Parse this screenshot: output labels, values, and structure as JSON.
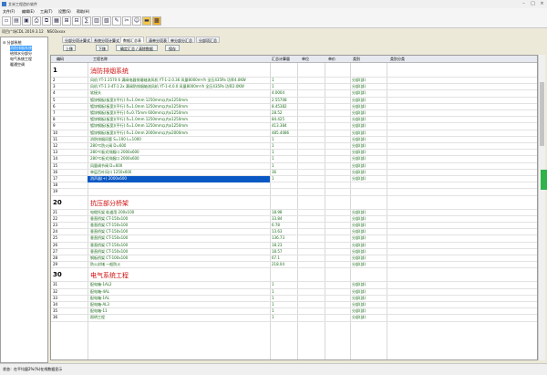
{
  "window": {
    "title": "艾米工程造价软件"
  },
  "menu": [
    "文件(F)",
    "编辑(E)",
    "工具(T)",
    "设置(S)",
    "帮助(H)"
  ],
  "project": {
    "label": "项目广场CDL 2019.3.12",
    "code": "NS03xxxx"
  },
  "tree": {
    "root": "分部系统",
    "items": [
      "消防排烟系统",
      "给排水分部分",
      "电气系统工程",
      "暖通空调"
    ]
  },
  "tabs": [
    "分部分项计算式",
    "系统分项计算式",
    "数据汇总表",
    "清单分项表",
    "单分部分汇总",
    "分部项汇总"
  ],
  "active_tab_index": 2,
  "buttons": {
    "up": "上移",
    "down": "下移",
    "summary": "确定汇总 / 清除数据",
    "save": "保存"
  },
  "columns": [
    "编码",
    "工程名称",
    "汇总计算量",
    "单位",
    "单价",
    "类别",
    "类别分类"
  ],
  "rows": [
    {
      "no": "1",
      "name": "消防排烟系统",
      "kind": "category"
    },
    {
      "no": "2",
      "name": "风机 YT-1 2570 6 满阀电器排烟轴流风机 YT-1-2.0.36 风量8000m³/h 全压435Pa 功率4.0KW",
      "qty": "1",
      "type": "分部(部)"
    },
    {
      "no": "3",
      "name": "风机 YT-1 3·4T-1 2x 满阀防排烟轴流风机 YT-1-4.0.0 风量8000m³/h 全压435Pa 功率2.0KW",
      "qty": "1",
      "type": "分部(部)"
    },
    {
      "no": "4",
      "name": "软接头",
      "qty": "4.0004",
      "type": "分部(部)"
    },
    {
      "no": "5",
      "name": "镀锌钢板(板宽)(平行) δ=1.0mm 1250mm以内x1250mm",
      "qty": "2.55708",
      "type": "分部(部)"
    },
    {
      "no": "6",
      "name": "镀锌钢板(板宽)(平行) δ=1.0mm 1250mm以内x1250mm",
      "qty": "8.45382",
      "type": "分部(部)"
    },
    {
      "no": "7",
      "name": "镀锌钢板(板宽)(平行) δ=0.75mm 600mm以内x1250mm",
      "qty": "28.52",
      "type": "分部(部)"
    },
    {
      "no": "8",
      "name": "镀锌钢板(板宽)(平行) δ=1.0mm 1250mm以内x1250mm",
      "qty": "84.425",
      "type": "分部(部)"
    },
    {
      "no": "9",
      "name": "镀锌钢板(板宽)(平行) δ=1.0mm 1250mm以内x1250mm",
      "qty": "413.384",
      "type": "分部(部)"
    },
    {
      "no": "10",
      "name": "镀锌钢板(板宽)(平行) δ=1.0mm 2000mm以内x2000mm",
      "qty": "485.4086",
      "type": "分部(部)"
    },
    {
      "no": "11",
      "name": "消防排烟风管 S=100 L=1000",
      "qty": "1",
      "type": "分部(部)"
    },
    {
      "no": "12",
      "name": "280℃防火阀 D=600",
      "qty": "1",
      "type": "分部(部)"
    },
    {
      "no": "13",
      "name": "280℃板式排烟口 2000x600",
      "qty": "1",
      "type": "分部(部)"
    },
    {
      "no": "14",
      "name": "280℃板式排烟口 2000x600",
      "qty": "1",
      "type": "分部(部)"
    },
    {
      "no": "15",
      "name": "风量调节阀 D=600",
      "qty": "1",
      "type": "分部(部)"
    },
    {
      "no": "16",
      "name": "单层百叶风口 1250x600",
      "qty": "36",
      "type": "分部(部)"
    },
    {
      "no": "17",
      "name": "消声器(+) 2000x600",
      "qty": "1",
      "type": "分部(部)",
      "selected": true
    },
    {
      "no": "18",
      "name": "",
      "qty": "",
      "type": ""
    },
    {
      "no": "19",
      "name": "",
      "qty": "",
      "type": ""
    },
    {
      "no": "20",
      "name": "抗压部分桥架",
      "kind": "category"
    },
    {
      "no": "21",
      "name": "电缆托架 轨道用 200x100",
      "qty": "18.98",
      "type": "分部(部)"
    },
    {
      "no": "22",
      "name": "垂直桥架 CT-150x100",
      "qty": "33.84",
      "type": "分部(部)"
    },
    {
      "no": "23",
      "name": "垂直桥架 CT-150x100",
      "qty": "6.78",
      "type": "分部(部)"
    },
    {
      "no": "24",
      "name": "垂直桥架 CT-150x100",
      "qty": "13.63",
      "type": "分部(部)"
    },
    {
      "no": "25",
      "name": "垂直桥架 CT-150x100",
      "qty": "136.73",
      "type": "分部(部)"
    },
    {
      "no": "26",
      "name": "垂直桥架 CT-150x100",
      "qty": "18.23",
      "type": "分部(部)"
    },
    {
      "no": "27",
      "name": "垂直桥架 CT-150x100",
      "qty": "18.57",
      "type": "分部(部)"
    },
    {
      "no": "28",
      "name": "钢板桥架 CT-100x100",
      "qty": "67.1",
      "type": "分部(部)"
    },
    {
      "no": "29",
      "name": "防火封堵 一般防火",
      "qty": "218.04",
      "type": "分部(部)"
    },
    {
      "no": "30",
      "name": "电气系统工程",
      "kind": "category"
    },
    {
      "no": "31",
      "name": "配电箱-1AL2",
      "qty": "1",
      "type": "分部(部)"
    },
    {
      "no": "32",
      "name": "配电箱-4AL",
      "qty": "1",
      "type": "分部(部)"
    },
    {
      "no": "33",
      "name": "配电箱-1AL",
      "qty": "1",
      "type": "分部(部)"
    },
    {
      "no": "34",
      "name": "配电箱-AL3",
      "qty": "1",
      "type": "分部(部)"
    },
    {
      "no": "35",
      "name": "配电箱-11",
      "qty": "1",
      "type": "分部(部)"
    },
    {
      "no": "36",
      "name": "照明工程",
      "qty": "1",
      "type": "分部(部)"
    }
  ],
  "status": "状态：在平均量2%(%)在线数据显示"
}
